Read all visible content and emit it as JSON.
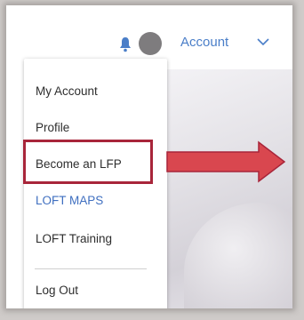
{
  "header": {
    "account_label": "Account",
    "bell_icon": "bell-icon",
    "avatar": "avatar",
    "chevron_icon": "chevron-down-icon",
    "account_color": "#4a7ec8"
  },
  "menu": {
    "items": [
      {
        "label": "My Account"
      },
      {
        "label": "Profile"
      },
      {
        "label": "Become an LFP"
      },
      {
        "label": "LOFT MAPS"
      },
      {
        "label": "LOFT Training"
      },
      {
        "label": "Log Out"
      }
    ]
  },
  "annotation": {
    "highlighted_item": "Become an LFP",
    "highlight_color": "#a8253a",
    "arrow_color": "#d9474f",
    "arrow_icon": "arrow-left-icon"
  }
}
